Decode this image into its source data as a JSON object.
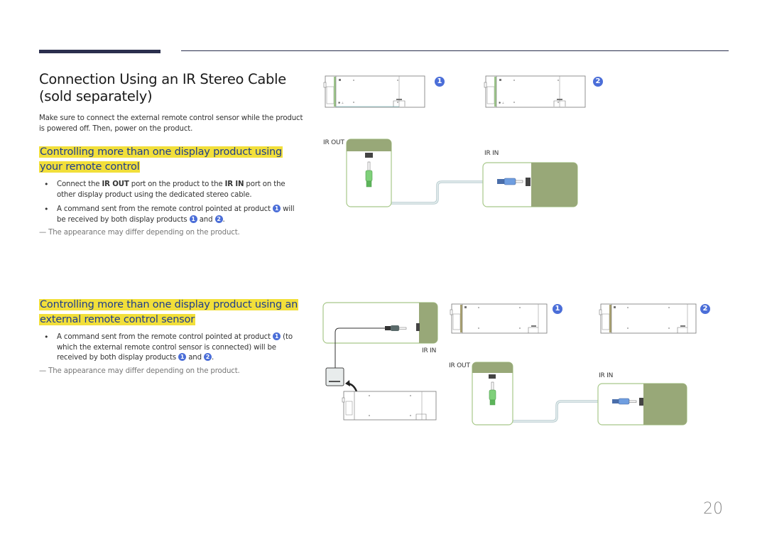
{
  "page": {
    "title": "Connection Using an IR Stereo Cable (sold separately)",
    "intro": "Make sure to connect the external remote control sensor while the product is powered off. Then, power on the product.",
    "page_number": "20"
  },
  "section1": {
    "heading_line1": "Controlling more than one display product using",
    "heading_line2": "your remote control",
    "bullet1": {
      "pre": "Connect the ",
      "port_out": "IR OUT",
      "mid": " port on the product to the ",
      "port_in": "IR IN",
      "post": " port on the other display product using the dedicated stereo cable."
    },
    "bullet2": {
      "pre": "A command sent from the remote control pointed at product ",
      "badge_a": "1",
      "mid": " will be received by both display products ",
      "badge_b": "1",
      "and": " and ",
      "badge_c": "2",
      "post": "."
    },
    "note": "The appearance may differ depending on the product."
  },
  "section2": {
    "heading_line1": "Controlling more than one display product using an",
    "heading_line2": "external remote control sensor",
    "bullet1": {
      "pre": "A command sent from the remote control pointed at product ",
      "badge_a": "1",
      "mid": " (to which the external remote control sensor is connected) will be received by both display products ",
      "badge_b": "1",
      "and": " and ",
      "badge_c": "2",
      "post": "."
    },
    "note": "The appearance may differ depending on the product."
  },
  "diagram1": {
    "product1_badge": "1",
    "product2_badge": "2",
    "ir_out_label": "IR OUT",
    "ir_in_label": "IR IN"
  },
  "diagram2": {
    "ir_in_label_sensor": "IR IN",
    "product1_badge": "1",
    "product2_badge": "2",
    "ir_out_label": "IR OUT",
    "ir_in_label": "IR IN"
  },
  "colors": {
    "accent_bar": "#2b2f4e",
    "highlight": "#f2df3a",
    "heading_text": "#1f3d8c",
    "badge": "#4b6ed8",
    "panel_green": "#98a878",
    "panel_border": "#a8c88a",
    "plug_green": "#7fd07a",
    "plug_blue": "#6f9ee0"
  }
}
